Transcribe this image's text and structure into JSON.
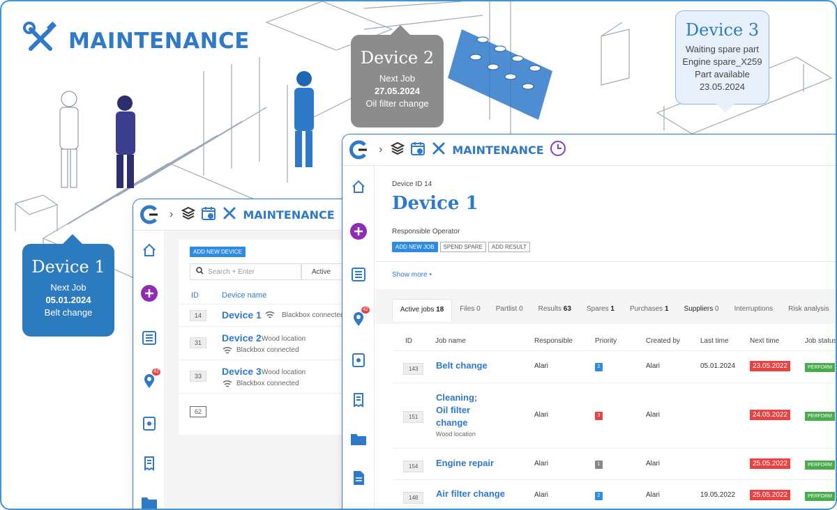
{
  "header": {
    "title": "MAINTENANCE"
  },
  "bubbles": [
    {
      "title": "Device 1",
      "line1": "Next Job",
      "line2": "05.01.2024",
      "line3": "Belt change"
    },
    {
      "title": "Device 2",
      "line1": "Next Job",
      "line2": "27.05.2024",
      "line3": "Oil filter change"
    },
    {
      "title": "Device 3",
      "line1": "Waiting spare part",
      "line2": "Engine spare_X259",
      "line3": "Part available",
      "line4": "23.05.2024"
    }
  ],
  "colors": {
    "brand": "#2f79c9",
    "bubble1": "#2c7bbf",
    "bubble2": "#8c8c8c",
    "danger": "#e74343",
    "success": "#49ac4c"
  },
  "winA": {
    "crumb_title": "MAINTENANCE",
    "add_device": "ADD NEW DEVICE",
    "search_placeholder": "Search + Enter",
    "filter": "Active",
    "col_id": "ID",
    "col_name": "Device name",
    "rows": [
      {
        "id": "14",
        "name": "Device 1",
        "status": "Blackbox connected"
      },
      {
        "id": "31",
        "name": "Device 2",
        "location": "Wood location",
        "status": "Blackbox connected"
      },
      {
        "id": "33",
        "name": "Device 3",
        "location": "Wood location",
        "status": "Blackbox connected"
      },
      {
        "id": "62"
      }
    ],
    "side_badge": "42"
  },
  "winB": {
    "crumb_title": "MAINTENANCE",
    "device_id": "Device ID 14",
    "device_title": "Device 1",
    "responsible_label": "Responsible Operator",
    "buttons": {
      "add_job": "ADD NEW JOB",
      "spend_spare": "SPEND SPARE",
      "add_result": "ADD RESULT"
    },
    "show_more": "Show more",
    "side_badge": "42",
    "tabs": [
      {
        "label": "Active jobs",
        "count": "18"
      },
      {
        "label": "Files",
        "count": "0"
      },
      {
        "label": "Partlist",
        "count": "0"
      },
      {
        "label": "Results",
        "count": "63"
      },
      {
        "label": "Spares",
        "count": "1"
      },
      {
        "label": "Purchases",
        "count": "1"
      },
      {
        "label": "Suppliers",
        "count": "0"
      },
      {
        "label": "Interruptions",
        "count": ""
      },
      {
        "label": "Risk analysis",
        "count": ""
      }
    ],
    "columns": [
      "ID",
      "Job name",
      "Responsible",
      "Priority",
      "Created by",
      "Last time",
      "Next time",
      "Job status"
    ],
    "jobs": [
      {
        "id": "143",
        "name": "Belt change",
        "sub": "",
        "responsible": "Alari",
        "priority": "2",
        "priority_color": "#2f8ae2",
        "created_by": "Alari",
        "last": "05.01.2024",
        "next": "23.05.2022",
        "status": "PERFORM"
      },
      {
        "id": "151",
        "name": "Cleaning; Oil filter change",
        "sub": "Wood location",
        "responsible": "Alari",
        "priority": "3",
        "priority_color": "#e74343",
        "created_by": "Alari",
        "last": "",
        "next": "24.05.2022",
        "status": "PERFORM"
      },
      {
        "id": "154",
        "name": "Engine repair",
        "sub": "",
        "responsible": "Alari",
        "priority": "1",
        "priority_color": "#888888",
        "created_by": "Alari",
        "last": "",
        "next": "25.05.2022",
        "status": "PERFORM"
      },
      {
        "id": "148",
        "name": "Air filter change",
        "sub": "",
        "responsible": "Alari",
        "priority": "2",
        "priority_color": "#2f8ae2",
        "created_by": "Alari",
        "last": "19.05.2022",
        "next": "25.05.2022",
        "status": "PERFORM"
      }
    ]
  }
}
